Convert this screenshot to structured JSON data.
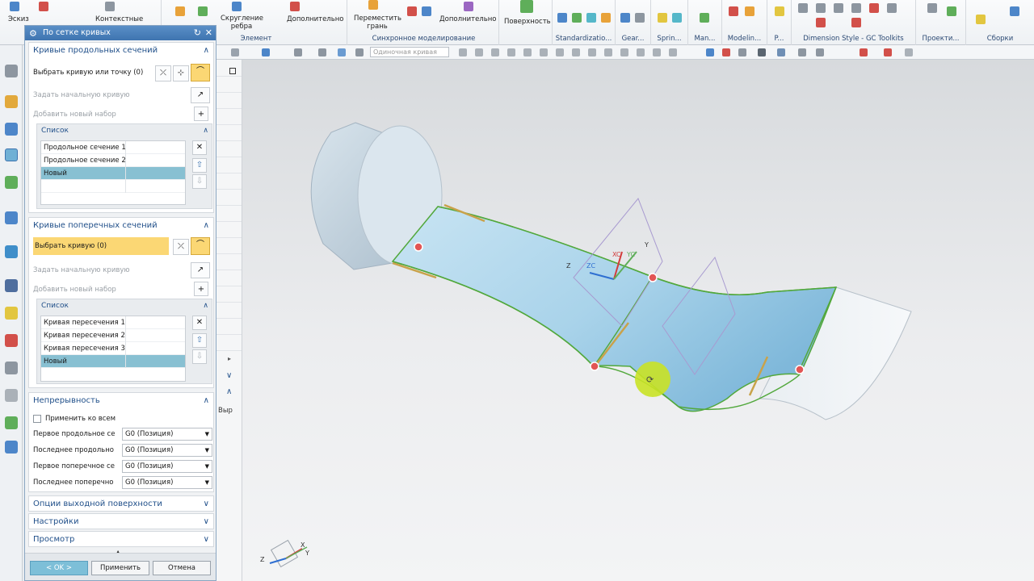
{
  "ribbon": {
    "buttons": {
      "sketch": "Эскиз",
      "contextual": "Контекстные",
      "fillet": "Скругление ребра",
      "more1": "Дополнительно",
      "move_face": "Переместить грань",
      "more2": "Дополнительно",
      "surface": "Поверхность"
    },
    "groups": {
      "feature": "Элемент",
      "sync": "Синхронное моделирование",
      "standardization": "Standardizatio...",
      "gear": "Gear...",
      "spring": "Sprin...",
      "man": "Man...",
      "modeling": "Modelin...",
      "p": "P...",
      "dim_style": "Dimension Style - GC Toolkits",
      "projection": "Проекти...",
      "assemblies": "Сборки"
    }
  },
  "toolbar2": {
    "filter_placeholder": "Одиночная кривая"
  },
  "navpane": {
    "label": "Выр"
  },
  "dialog": {
    "title": "По сетке кривых",
    "primary": {
      "header": "Кривые продольных сечений",
      "select": "Выбрать кривую или точку (0)",
      "start_curve": "Задать начальную кривую",
      "add_set": "Добавить новый набор",
      "list_header": "Список",
      "items": [
        "Продольное сечение 1",
        "Продольное сечение 2",
        "Новый"
      ]
    },
    "cross": {
      "header": "Кривые поперечных сечений",
      "select": "Выбрать кривую (0)",
      "start_curve": "Задать начальную кривую",
      "add_set": "Добавить новый набор",
      "list_header": "Список",
      "items": [
        "Кривая пересечения 1",
        "Кривая пересечения 2",
        "Кривая пересечения 3",
        "Новый"
      ]
    },
    "continuity": {
      "header": "Непрерывность",
      "apply_all": "Применить ко всем",
      "rows": [
        {
          "label": "Первое продольное се",
          "value": "G0 (Позиция)"
        },
        {
          "label": "Последнее продольно",
          "value": "G0 (Позиция)"
        },
        {
          "label": "Первое поперечное се",
          "value": "G0 (Позиция)"
        },
        {
          "label": "Последнее поперечно",
          "value": "G0 (Позиция)"
        }
      ]
    },
    "collapsed": [
      "Опции выходной поверхности",
      "Настройки",
      "Просмотр"
    ],
    "buttons": {
      "ok": "< OK >",
      "apply": "Применить",
      "cancel": "Отмена"
    }
  },
  "viewport": {
    "triad": {
      "x": "X",
      "y": "Y",
      "z": "Z"
    },
    "wcs": {
      "z": "Z",
      "zc": "ZC",
      "xc": "XC",
      "yc": "YC",
      "y": "Y"
    }
  },
  "colors": {
    "accent": "#3e74b0",
    "selection": "#fbd774",
    "list_selected": "#88c0d2",
    "surface": "#a9d3ea",
    "edge": "#52a83c"
  }
}
